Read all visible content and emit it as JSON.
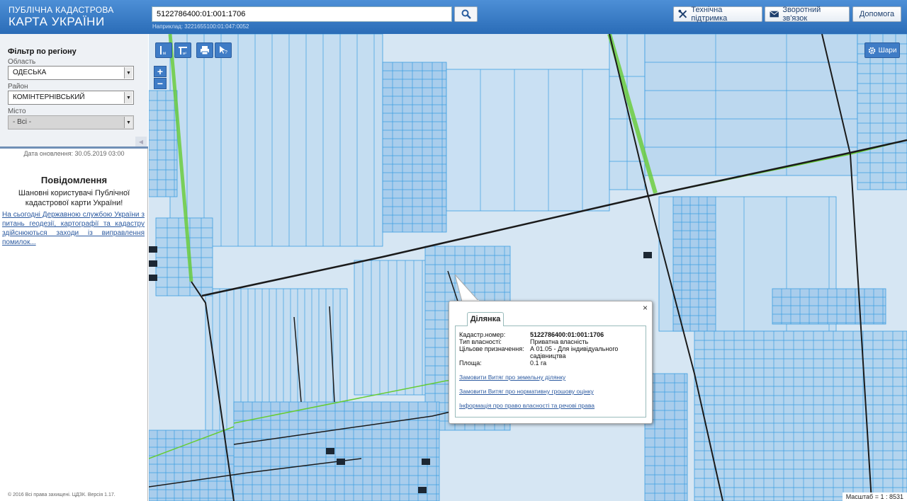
{
  "header": {
    "logo_line1": "ПУБЛІЧНА КАДАСТРОВА",
    "logo_line2": "КАРТА УКРАЇНИ",
    "search_value": "5122786400:01:001:1706",
    "example": "Наприклад: 3221655100:01:047:0052",
    "support_label": "Технічна підтримка",
    "feedback_label": "Зворотний зв'язок",
    "help_label": "Допомога"
  },
  "sidebar": {
    "filter_title": "Фільтр по регіону",
    "region_label": "Область",
    "region_value": "ОДЕСЬКА",
    "district_label": "Район",
    "district_value": "КОМІНТЕРНІВСЬКИЙ",
    "city_label": "Місто",
    "city_value": "- Всі -",
    "update_date": "Дата оновлення: 30.05.2019 03:00",
    "notice_title": "Повідомлення",
    "notice_text": "Шановні користувачі Публічної кадастрової карти України!",
    "notice_link": "На сьогодні Державною службою України з питань геодезії, картографії та кадастру здійснюються заходи із виправлення помилок...",
    "copyright": "© 2016 Всі права захищені. ЦДЗК. Версія 1.17."
  },
  "map": {
    "layers_label": "Шари",
    "zoom_in": "+",
    "zoom_out": "−",
    "scale": "Масштаб = 1 : 8531",
    "parcel_fill": "#b9d8f0",
    "parcel_stroke": "#3d9ee0",
    "road_color": "#1a1a1a",
    "boundary_color": "#66cc33"
  },
  "popup": {
    "tab_label": "Ділянка",
    "close": "×",
    "rows": [
      {
        "key": "Кадастр.номер:",
        "value": "5122786400:01:001:1706"
      },
      {
        "key": "Тип власності:",
        "value": "Приватна власність"
      },
      {
        "key": "Цільове призначення:",
        "value": "А 01.05 - Для індивідуального садівництва"
      },
      {
        "key": "Площа:",
        "value": "0.1 га"
      }
    ],
    "link1": "Замовити Витяг про земельну ділянку",
    "link2": "Замовити Витяг про нормативну грошову оцінку",
    "link3": "Інформація про право власності та речові права"
  }
}
